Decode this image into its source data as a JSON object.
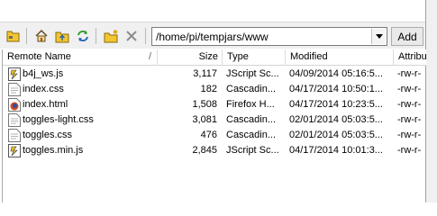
{
  "toolbar": {
    "path": "/home/pi/tempjars/www",
    "add_label": "Add"
  },
  "columns": {
    "name": "Remote Name",
    "size": "Size",
    "type": "Type",
    "modified": "Modified",
    "attributes": "Attribu"
  },
  "sort_indicator": "/",
  "files": [
    {
      "name": "b4j_ws.js",
      "size": "3,117",
      "type": "JScript Sc...",
      "modified": "04/09/2014 05:16:5...",
      "attr": "-rw-r-",
      "icon": "jscript-file-icon"
    },
    {
      "name": "index.css",
      "size": "182",
      "type": "Cascadin...",
      "modified": "04/17/2014 10:50:1...",
      "attr": "-rw-r-",
      "icon": "css-file-icon"
    },
    {
      "name": "index.html",
      "size": "1,508",
      "type": "Firefox H...",
      "modified": "04/17/2014 10:23:5...",
      "attr": "-rw-r-",
      "icon": "html-file-icon"
    },
    {
      "name": "toggles-light.css",
      "size": "3,081",
      "type": "Cascadin...",
      "modified": "02/01/2014 05:03:5...",
      "attr": "-rw-r-",
      "icon": "css-file-icon"
    },
    {
      "name": "toggles.css",
      "size": "476",
      "type": "Cascadin...",
      "modified": "02/01/2014 05:03:5...",
      "attr": "-rw-r-",
      "icon": "css-file-icon"
    },
    {
      "name": "toggles.min.js",
      "size": "2,845",
      "type": "JScript Sc...",
      "modified": "04/17/2014 10:01:3...",
      "attr": "-rw-r-",
      "icon": "jscript-file-icon"
    }
  ],
  "colors": {
    "folder": "#f3c62f",
    "accent_green": "#2a9a2a",
    "firefox": "#d6481b"
  }
}
